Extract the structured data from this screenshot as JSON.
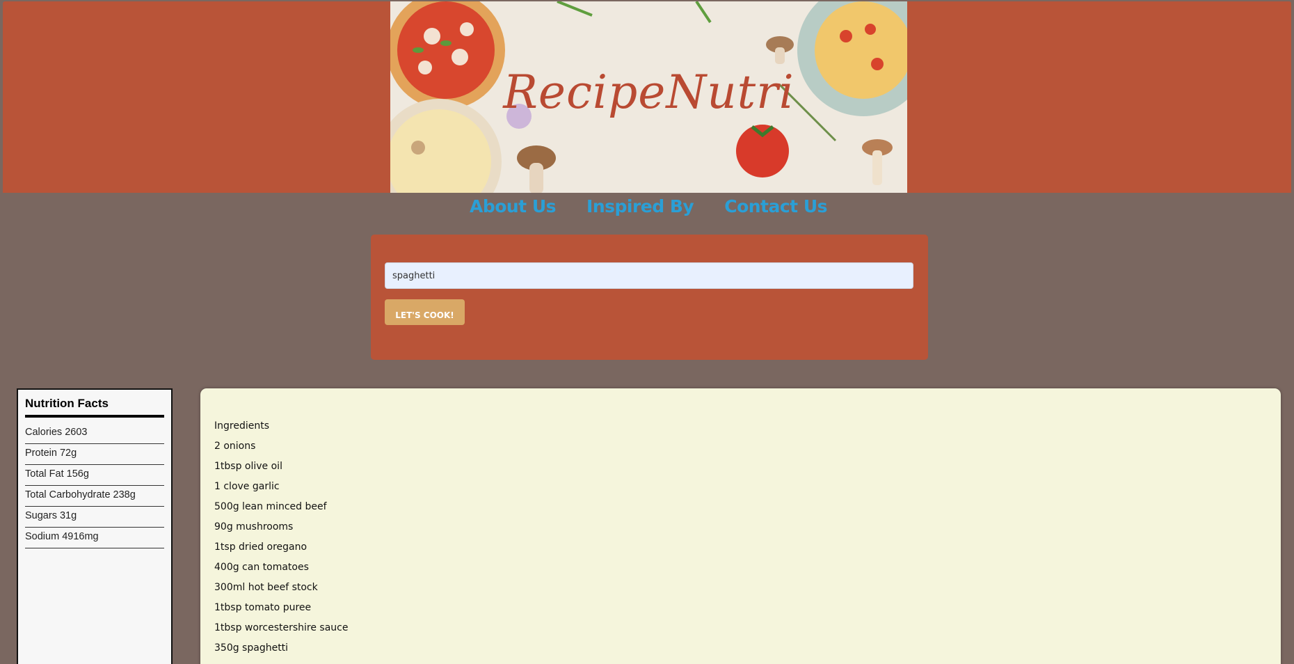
{
  "header": {
    "banner_title": "RecipeNutri"
  },
  "nav": {
    "items": [
      "About Us",
      "Inspired By",
      "Contact Us"
    ]
  },
  "search": {
    "value": "spaghetti",
    "button_label": "LET'S COOK!"
  },
  "nutrition": {
    "title": "Nutrition Facts",
    "rows": [
      "Calories 2603",
      "Protein 72g",
      "Total Fat 156g",
      "Total Carbohydrate 238g",
      "Sugars 31g",
      "Sodium 4916mg"
    ]
  },
  "recipe": {
    "lines": [
      "Ingredients",
      "2 onions",
      "1tbsp olive oil",
      "1 clove garlic",
      "500g lean minced beef",
      "90g mushrooms",
      "1tsp dried oregano",
      "400g can tomatoes",
      "300ml hot beef stock",
      "1tbsp tomato puree",
      "1tbsp worcestershire sauce",
      "350g spaghetti"
    ]
  },
  "colors": {
    "header_bg": "#b95438",
    "page_bg": "#7a6760",
    "nav_link": "#2a9fd6",
    "button": "#d9a866",
    "recipe_bg": "#f5f5dc"
  }
}
